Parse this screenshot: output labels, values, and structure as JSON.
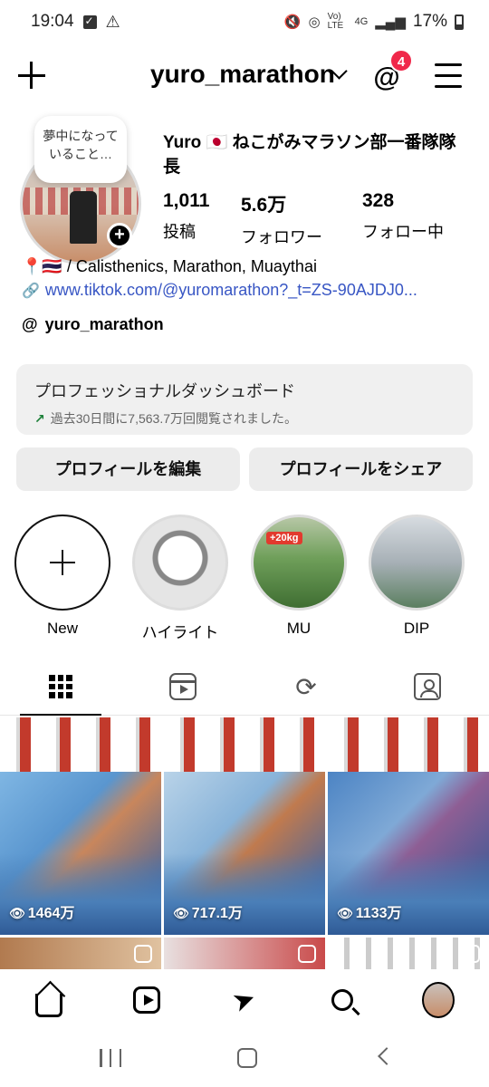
{
  "status_bar": {
    "time": "19:04",
    "battery": "17%",
    "network": "4G",
    "volte": "Vo) LTE"
  },
  "header": {
    "username": "yuro_marathon",
    "notification_count": "4"
  },
  "profile": {
    "note": "夢中になっていること…",
    "display_name": "Yuro 🇯🇵 ねこがみマラソン部一番隊隊長",
    "stats": [
      {
        "value": "1,011",
        "label": "投稿"
      },
      {
        "value": "5.6万",
        "label": "フォロワー"
      },
      {
        "value": "328",
        "label": "フォロー中"
      }
    ],
    "bio": "📍🇹🇭 / Calisthenics, Marathon, Muaythai",
    "link": "www.tiktok.com/@yuromarathon?_t=ZS-90AJDJ0...",
    "threads_handle": "yuro_marathon"
  },
  "dashboard": {
    "title": "プロフェッショナルダッシュボード",
    "subtitle": "過去30日間に7,563.7万回閲覧されました。"
  },
  "buttons": {
    "edit": "プロフィールを編集",
    "share": "プロフィールをシェア"
  },
  "highlights": [
    {
      "label": "New"
    },
    {
      "label": "ハイライト"
    },
    {
      "label": "MU",
      "badge": "+20kg"
    },
    {
      "label": "DIP"
    }
  ],
  "posts": [
    {
      "views": "1464万"
    },
    {
      "views": "717.1万"
    },
    {
      "views": "1133万"
    }
  ],
  "colors": {
    "accent_link": "#3856c4",
    "badge_red": "#f0284a",
    "trend_green": "#1a7f37"
  }
}
